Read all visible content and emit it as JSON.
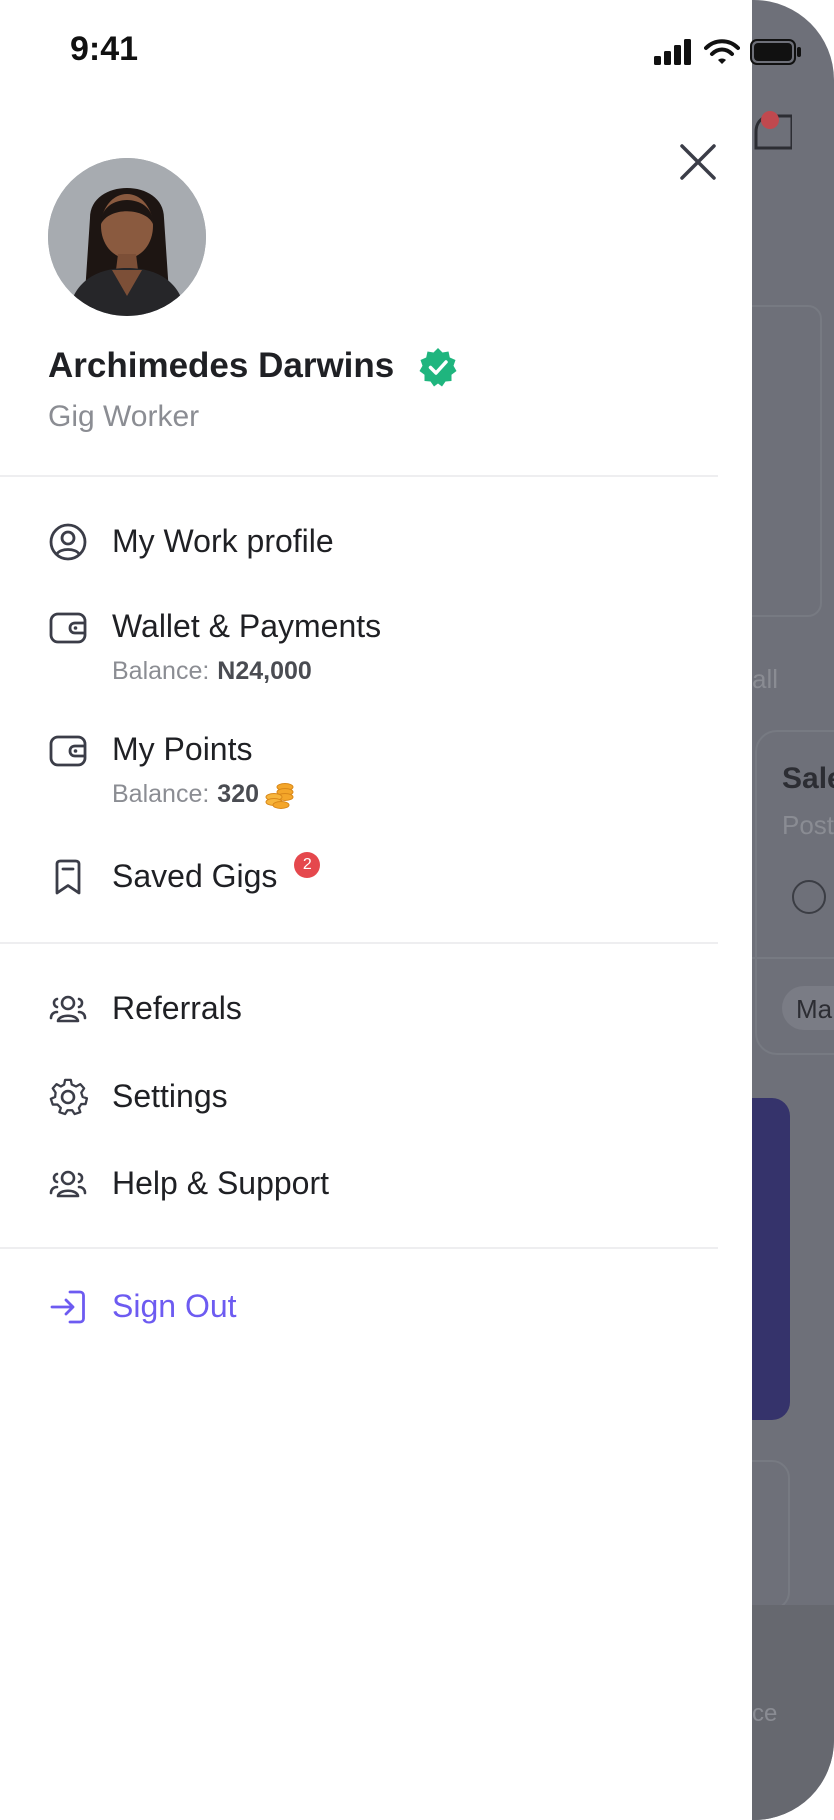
{
  "status": {
    "time": "9:41"
  },
  "profile": {
    "name": "Archimedes Darwins",
    "role": "Gig Worker"
  },
  "menu": {
    "work_profile": {
      "label": "My Work profile"
    },
    "wallet": {
      "label": "Wallet & Payments",
      "balance_label": "Balance:",
      "balance_value": "N24,000"
    },
    "points": {
      "label": "My Points",
      "balance_label": "Balance:",
      "balance_value": "320"
    },
    "saved_gigs": {
      "label": "Saved Gigs",
      "badge": "2"
    },
    "referrals": {
      "label": "Referrals"
    },
    "settings": {
      "label": "Settings"
    },
    "help": {
      "label": "Help & Support"
    },
    "sign_out": {
      "label": "Sign Out"
    }
  },
  "background": {
    "see_all": "all",
    "gig_title": "Sale",
    "gig_sub": "Post",
    "chip": "Ma",
    "nav_text": "ce"
  },
  "colors": {
    "accent": "#6d5bf1",
    "verified": "#1fb57e",
    "badge": "#e5484d",
    "text_primary": "#1f2024",
    "text_secondary": "#8b8d93",
    "overlay": "#6e7079"
  },
  "icons": {
    "close": "close-icon",
    "verified": "verified-badge-icon",
    "work_profile": "user-circle-icon",
    "wallet": "wallet-icon",
    "points": "wallet-icon",
    "coins": "coins-icon",
    "saved_gigs": "bookmark-icon",
    "referrals": "users-icon",
    "settings": "gear-icon",
    "help": "users-icon",
    "sign_out": "login-icon"
  }
}
